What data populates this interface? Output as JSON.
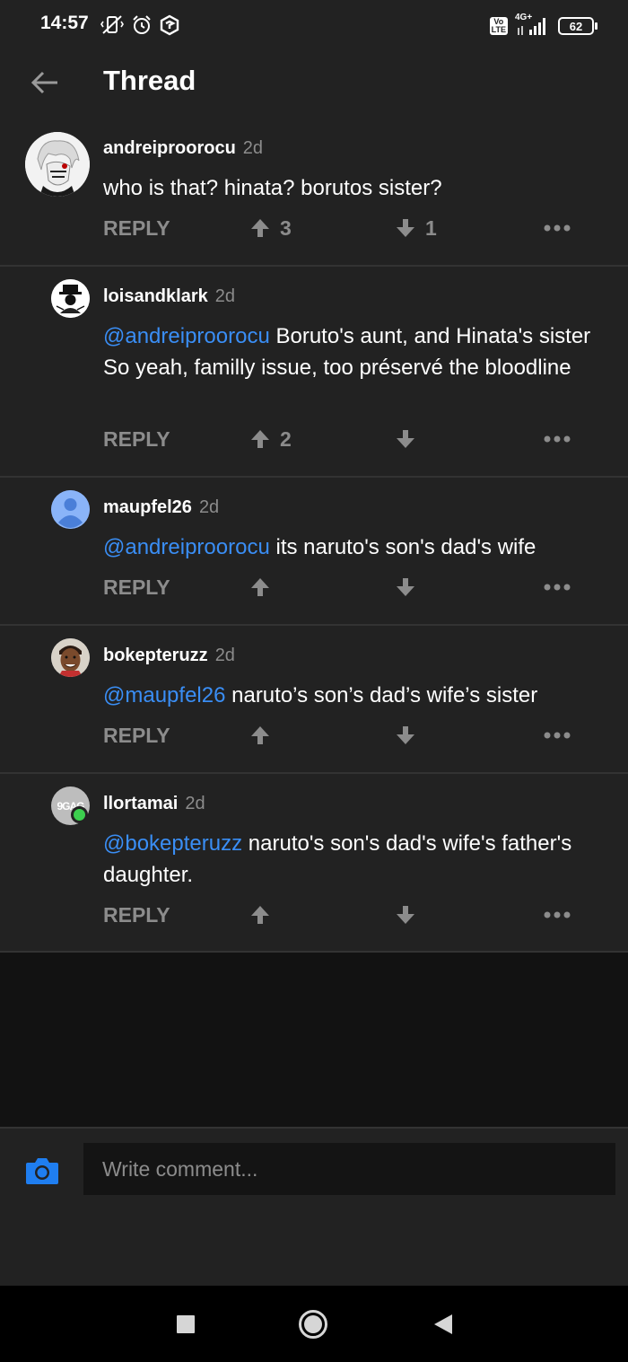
{
  "status_bar": {
    "time": "14:57",
    "network": "4G+",
    "volte": "Vo LTE",
    "battery": "62"
  },
  "header": {
    "title": "Thread",
    "back_icon": "arrow-left-icon"
  },
  "colors": {
    "background": "#222222",
    "mention": "#3a8ef5",
    "muted": "#8c8c8c",
    "camera_accent": "#1f7ef0"
  },
  "comments": [
    {
      "username": "andreiproorocu",
      "age": "2d",
      "mention": "",
      "text": "who is that? hinata? borutos sister?",
      "reply_label": "REPLY",
      "upvotes": "3",
      "downvotes": "1"
    },
    {
      "username": "loisandklark",
      "age": "2d",
      "mention": "@andreiproorocu",
      "text": " Boruto's aunt, and Hinata's sister\nSo yeah, familly issue, too préservé the bloodline",
      "reply_label": "REPLY",
      "upvotes": "2",
      "downvotes": ""
    },
    {
      "username": "maupfel26",
      "age": "2d",
      "mention": "@andreiproorocu",
      "text": " its naruto's son's dad's wife",
      "reply_label": "REPLY",
      "upvotes": "",
      "downvotes": ""
    },
    {
      "username": "bokepteruzz",
      "age": "2d",
      "mention": "@maupfel26",
      "text": " naruto’s son’s dad’s wife’s sister",
      "reply_label": "REPLY",
      "upvotes": "",
      "downvotes": ""
    },
    {
      "username": "llortamai",
      "age": "2d",
      "mention": "@bokepteruzz",
      "text": " naruto's son's dad's wife's father's daughter.",
      "reply_label": "REPLY",
      "upvotes": "",
      "downvotes": "",
      "avatar_text": "9GAG"
    }
  ],
  "composer": {
    "placeholder": "Write comment...",
    "camera_icon": "camera-icon"
  },
  "nav": {
    "recents_icon": "square-icon",
    "home_icon": "circle-icon",
    "back_icon": "triangle-back-icon"
  }
}
